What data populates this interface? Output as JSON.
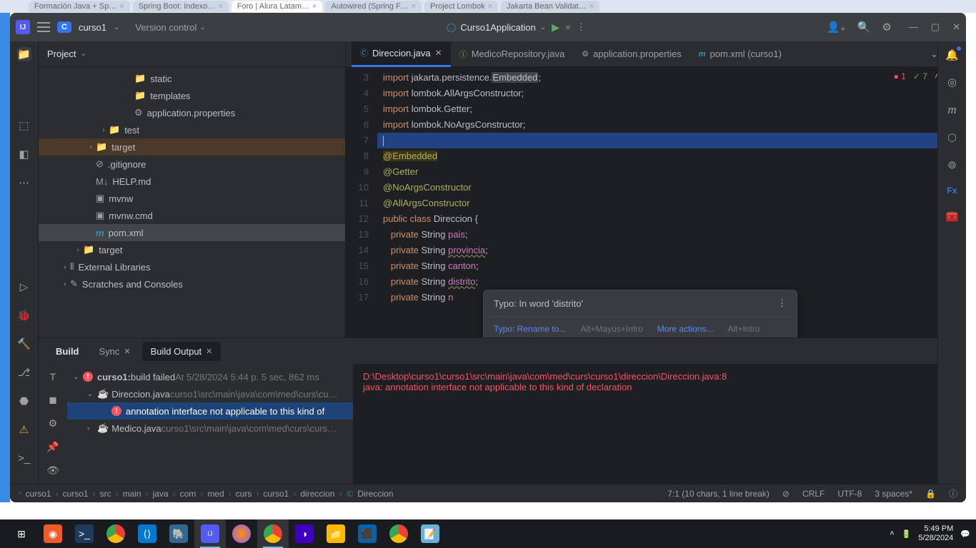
{
  "browserTabs": [
    {
      "label": "Formación Java + Sp…",
      "active": false
    },
    {
      "label": "Spring Boot: Indexo…",
      "active": false
    },
    {
      "label": "Foro | Alura Latam…",
      "active": true
    },
    {
      "label": "Autowired (Spring F…",
      "active": false
    },
    {
      "label": "Project Lombok",
      "active": false
    },
    {
      "label": "Jakarta Bean Validat…",
      "active": false
    }
  ],
  "titlebar": {
    "projectBadge": "C",
    "projectName": "curso1",
    "vcs": "Version control",
    "runConfig": "Curso1Application"
  },
  "projectPanel": {
    "title": "Project"
  },
  "tree": [
    {
      "depth": 6,
      "arrow": "",
      "icon": "folder",
      "label": "static"
    },
    {
      "depth": 6,
      "arrow": "",
      "icon": "folder",
      "label": "templates"
    },
    {
      "depth": 6,
      "arrow": "",
      "icon": "gear",
      "label": "application.properties"
    },
    {
      "depth": 4,
      "arrow": "›",
      "icon": "folder",
      "label": "test"
    },
    {
      "depth": 3,
      "arrow": "›",
      "icon": "folder-hl",
      "label": "target",
      "hl": true
    },
    {
      "depth": 3,
      "arrow": "",
      "icon": "ignore",
      "label": ".gitignore"
    },
    {
      "depth": 3,
      "arrow": "",
      "icon": "md",
      "label": "HELP.md"
    },
    {
      "depth": 3,
      "arrow": "",
      "icon": "sh",
      "label": "mvnw"
    },
    {
      "depth": 3,
      "arrow": "",
      "icon": "sh",
      "label": "mvnw.cmd"
    },
    {
      "depth": 3,
      "arrow": "",
      "icon": "mvn",
      "label": "pom.xml",
      "sel": true
    },
    {
      "depth": 2,
      "arrow": "›",
      "icon": "folder",
      "label": "target"
    },
    {
      "depth": 1,
      "arrow": "›",
      "icon": "lib",
      "label": "External Libraries"
    },
    {
      "depth": 1,
      "arrow": "›",
      "icon": "scratch",
      "label": "Scratches and Consoles"
    }
  ],
  "editorTabs": [
    {
      "icon": "c",
      "label": "Direccion.java",
      "active": true,
      "close": true
    },
    {
      "icon": "i",
      "label": "MedicoRepository.java",
      "active": false
    },
    {
      "icon": "g",
      "label": "application.properties",
      "active": false
    },
    {
      "icon": "m",
      "label": "pom.xml (curso1)",
      "active": false
    }
  ],
  "inspection": {
    "errors": "1",
    "warnings": "7"
  },
  "code": {
    "startLine": 3,
    "lines": [
      {
        "n": 3,
        "html": "<span class='kw'>import</span> jakarta.persistence.<span class='hl-box'>Embedded</span>;"
      },
      {
        "n": 4,
        "html": "<span class='kw'>import</span> lombok.<span class='cls'>AllArgsConstructor</span>;"
      },
      {
        "n": 5,
        "html": "<span class='kw'>import</span> lombok.<span class='cls'>Getter</span>;"
      },
      {
        "n": 6,
        "html": "<span class='kw'>import</span> lombok.<span class='cls'>NoArgsConstructor</span>;"
      },
      {
        "n": 7,
        "html": "<span class='cursor-bar'></span>",
        "sel": true
      },
      {
        "n": 8,
        "html": "<span class='ann-hl'>@Embedded</span>"
      },
      {
        "n": 9,
        "html": "<span class='ann'>@Getter</span>"
      },
      {
        "n": 10,
        "html": "<span class='ann'>@NoArgsConstructor</span>"
      },
      {
        "n": 11,
        "html": "<span class='ann'>@AllArgsConstructor</span>"
      },
      {
        "n": 12,
        "html": "<span class='kw'>public</span> <span class='kw'>class</span> <span class='type'>Direccion</span> {"
      },
      {
        "n": 13,
        "html": "   <span class='kw'>private</span> <span class='type'>String</span> <span class='field'>pais</span>;"
      },
      {
        "n": 14,
        "html": "   <span class='kw'>private</span> <span class='type'>String</span> <span class='field-u'>provincia</span>;"
      },
      {
        "n": 15,
        "html": "   <span class='kw'>private</span> <span class='type'>String</span> <span class='field'>canton</span>;"
      },
      {
        "n": 16,
        "html": "   <span class='kw'>private</span> <span class='type'>String</span> <span class='field-u'>distrito</span>;"
      },
      {
        "n": 17,
        "html": "   <span class='kw'>private</span> <span class='type'>String</span> <span class='field'>n</span>"
      }
    ]
  },
  "hint": {
    "title": "Typo: In word 'distrito'",
    "action1": "Typo: Rename to...",
    "sc1": "Alt+Mayús+Intro",
    "action2": "More actions...",
    "sc2": "Alt+Intro"
  },
  "buildTabs": {
    "build": "Build",
    "sync": "Sync",
    "output": "Build Output"
  },
  "buildTree": [
    {
      "depth": 0,
      "arrow": "⌄",
      "err": true,
      "boldA": "curso1:",
      "boldB": "build failed",
      "gray": "At 5/28/2024 5:44 p. 5 sec, 862 ms"
    },
    {
      "depth": 1,
      "arrow": "⌄",
      "java": true,
      "label": "Direccion.java",
      "gray": "curso1\\src\\main\\java\\com\\med\\curs\\cu…"
    },
    {
      "depth": 2,
      "arrow": "",
      "err": true,
      "label": "annotation interface not applicable to this kind of",
      "sel": true
    },
    {
      "depth": 1,
      "arrow": "›",
      "java": true,
      "label": "Medico.java",
      "gray": "curso1\\src\\main\\java\\com\\med\\curs\\curs…"
    }
  ],
  "buildOutput": {
    "line1": "D:\\Desktop\\curso1\\curso1\\src\\main\\java\\com\\med\\curs\\curso1\\direccion\\Direccion.java:8",
    "line2": "java: annotation interface not applicable to this kind of declaration"
  },
  "breadcrumbs": [
    "curso1",
    "curso1",
    "src",
    "main",
    "java",
    "com",
    "med",
    "curs",
    "curso1",
    "direccion",
    "Direccion"
  ],
  "status": {
    "pos": "7:1 (10 chars, 1 line break)",
    "sep": "CRLF",
    "enc": "UTF-8",
    "indent": "3 spaces*"
  },
  "clock": {
    "time": "5:49 PM",
    "date": "5/28/2024"
  }
}
